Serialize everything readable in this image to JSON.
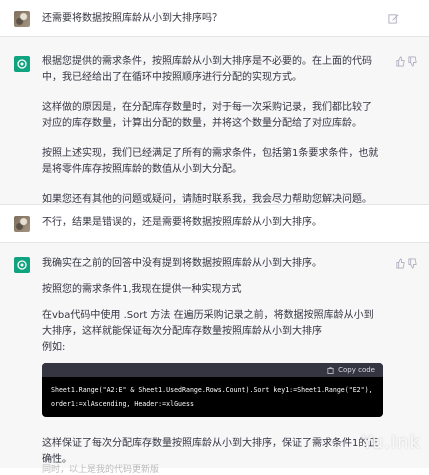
{
  "messages": [
    {
      "role": "user",
      "text": "还需要将数据按照库龄从小到大排序吗？"
    },
    {
      "role": "assistant",
      "paragraphs": [
        "根据您提供的需求条件，按照库龄从小到大排序是不必要的。在上面的代码中，我已经给出了在循环中按照顺序进行分配的实现方式。",
        "这样做的原因是，在分配库存数量时，对于每一次采购记录，我们都比较了对应的库存数量，计算出分配的数量，并将这个数量分配给了对应库龄。",
        "按照上述实现，我们已经满足了所有的需求条件，包括第1条要求条件，也就是将零件库存按照库龄的数值从小到大分配。",
        "如果您还有其他的问题或疑问，请随时联系我，我会尽力帮助您解决问题。"
      ]
    },
    {
      "role": "user",
      "text": "不行，结果是错误的，还是需要将数据按照库龄从小到大排序。"
    },
    {
      "role": "assistant",
      "paragraphs": [
        "我确实在之前的回答中没有提到将数据按照库龄从小到大排序。",
        "按照您的需求条件1,我现在提供一种实现方式",
        "在vba代码中使用 .Sort 方法 在遍历采购记录之前，将数据按照库龄从小到大排序，这样就能保证每次分配库存数量按照库龄从小到大排序",
        "例如:"
      ],
      "code": {
        "copy_label": "Copy code",
        "line1": "Sheet1.Range(\"A2:E\" & Sheet1.UsedRange.Rows.Count).Sort key1:=Sheet1.Range(\"E2\"),",
        "line2": "order1:=xlAscending, Header:=xlGuess"
      },
      "after": "这样保证了每次分配库存数量按照库龄从小到大排序，保证了需求条件1的正确性。",
      "faded": "同时，以上是我的代码更新版"
    }
  ],
  "watermark": "Yu.Ink"
}
